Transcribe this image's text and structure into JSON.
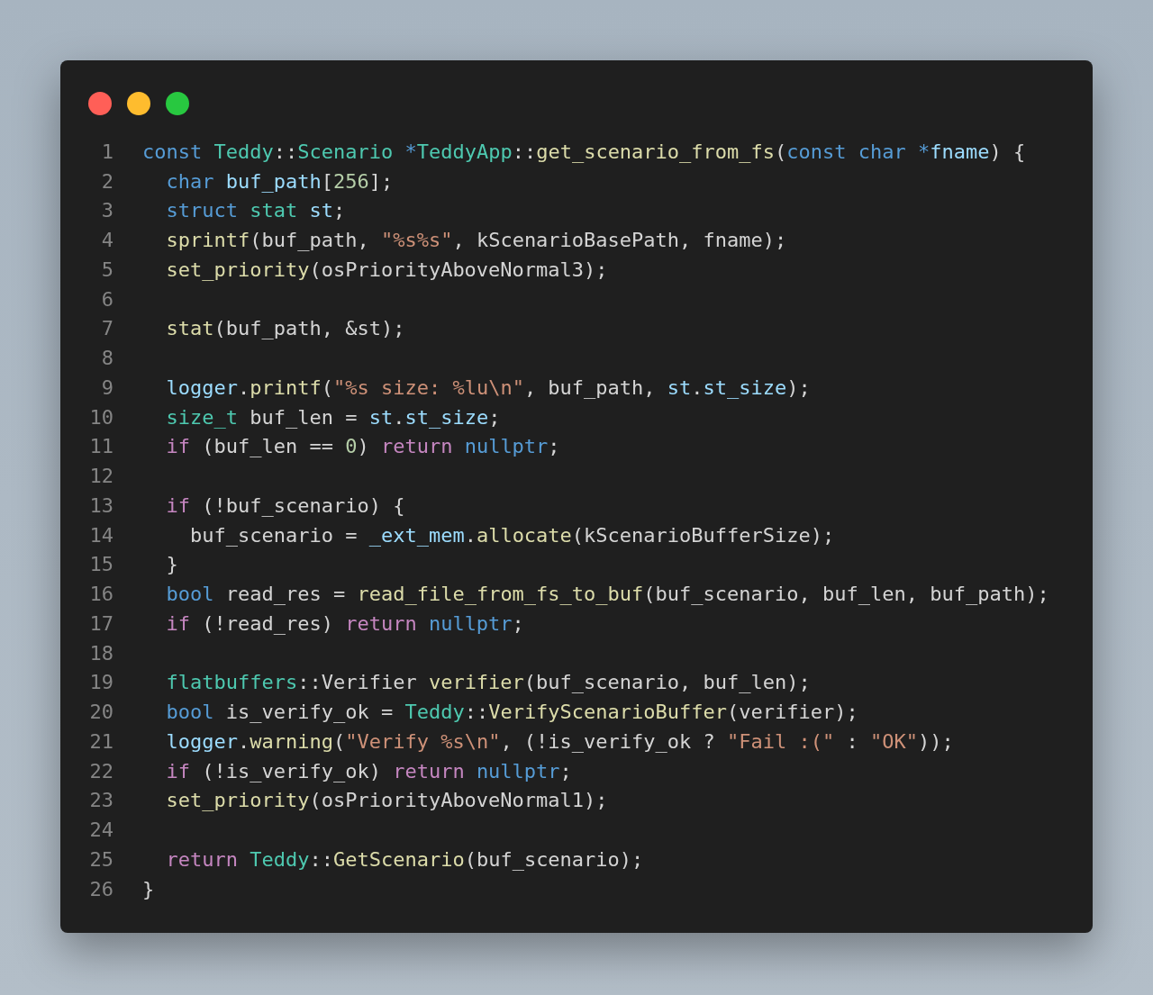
{
  "code_lines": [
    {
      "number": "1",
      "tokens": [
        {
          "kind": "keyword",
          "text": "const "
        },
        {
          "kind": "type",
          "text": "Teddy"
        },
        {
          "kind": "plain",
          "text": "::"
        },
        {
          "kind": "type",
          "text": "Scenario "
        },
        {
          "kind": "keyword",
          "text": "*"
        },
        {
          "kind": "type",
          "text": "TeddyApp"
        },
        {
          "kind": "plain",
          "text": "::"
        },
        {
          "kind": "function",
          "text": "get_scenario_from_fs"
        },
        {
          "kind": "plain",
          "text": "("
        },
        {
          "kind": "keyword",
          "text": "const char *"
        },
        {
          "kind": "variable",
          "text": "fname"
        },
        {
          "kind": "plain",
          "text": ") {"
        }
      ]
    },
    {
      "number": "2",
      "tokens": [
        {
          "kind": "keyword",
          "text": "  char "
        },
        {
          "kind": "variable",
          "text": "buf_path"
        },
        {
          "kind": "plain",
          "text": "["
        },
        {
          "kind": "number",
          "text": "256"
        },
        {
          "kind": "plain",
          "text": "];"
        }
      ]
    },
    {
      "number": "3",
      "tokens": [
        {
          "kind": "keyword",
          "text": "  struct "
        },
        {
          "kind": "type",
          "text": "stat "
        },
        {
          "kind": "variable",
          "text": "st"
        },
        {
          "kind": "plain",
          "text": ";"
        }
      ]
    },
    {
      "number": "4",
      "tokens": [
        {
          "kind": "function",
          "text": "  sprintf"
        },
        {
          "kind": "plain",
          "text": "(buf_path, "
        },
        {
          "kind": "string",
          "text": "\"%s%s\""
        },
        {
          "kind": "plain",
          "text": ", kScenarioBasePath, fname);"
        }
      ]
    },
    {
      "number": "5",
      "tokens": [
        {
          "kind": "function",
          "text": "  set_priority"
        },
        {
          "kind": "plain",
          "text": "(osPriorityAboveNormal3);"
        }
      ]
    },
    {
      "number": "6"
    },
    {
      "number": "7",
      "tokens": [
        {
          "kind": "function",
          "text": "  stat"
        },
        {
          "kind": "plain",
          "text": "(buf_path, &st);"
        }
      ]
    },
    {
      "number": "8"
    },
    {
      "number": "9",
      "tokens": [
        {
          "kind": "variable",
          "text": "  logger"
        },
        {
          "kind": "plain",
          "text": "."
        },
        {
          "kind": "function",
          "text": "printf"
        },
        {
          "kind": "plain",
          "text": "("
        },
        {
          "kind": "string",
          "text": "\"%s size: %lu\\n\""
        },
        {
          "kind": "plain",
          "text": ", buf_path, "
        },
        {
          "kind": "variable",
          "text": "st"
        },
        {
          "kind": "plain",
          "text": "."
        },
        {
          "kind": "variable",
          "text": "st_size"
        },
        {
          "kind": "plain",
          "text": ");"
        }
      ]
    },
    {
      "number": "10",
      "tokens": [
        {
          "kind": "type",
          "text": "  size_t"
        },
        {
          "kind": "plain",
          "text": " buf_len = "
        },
        {
          "kind": "variable",
          "text": "st"
        },
        {
          "kind": "plain",
          "text": "."
        },
        {
          "kind": "variable",
          "text": "st_size"
        },
        {
          "kind": "plain",
          "text": ";"
        }
      ]
    },
    {
      "number": "11",
      "tokens": [
        {
          "kind": "control",
          "text": "  if"
        },
        {
          "kind": "plain",
          "text": " (buf_len == "
        },
        {
          "kind": "number",
          "text": "0"
        },
        {
          "kind": "plain",
          "text": ") "
        },
        {
          "kind": "control",
          "text": "return "
        },
        {
          "kind": "keyword",
          "text": "nullptr"
        },
        {
          "kind": "plain",
          "text": ";"
        }
      ]
    },
    {
      "number": "12"
    },
    {
      "number": "13",
      "tokens": [
        {
          "kind": "control",
          "text": "  if"
        },
        {
          "kind": "plain",
          "text": " (!buf_scenario) {"
        }
      ]
    },
    {
      "number": "14",
      "tokens": [
        {
          "kind": "plain",
          "text": "    buf_scenario = "
        },
        {
          "kind": "variable",
          "text": "_ext_mem"
        },
        {
          "kind": "plain",
          "text": "."
        },
        {
          "kind": "function",
          "text": "allocate"
        },
        {
          "kind": "plain",
          "text": "(kScenarioBufferSize);"
        }
      ]
    },
    {
      "number": "15",
      "tokens": [
        {
          "kind": "plain",
          "text": "  }"
        }
      ]
    },
    {
      "number": "16",
      "tokens": [
        {
          "kind": "keyword",
          "text": "  bool"
        },
        {
          "kind": "plain",
          "text": " read_res = "
        },
        {
          "kind": "function",
          "text": "read_file_from_fs_to_buf"
        },
        {
          "kind": "plain",
          "text": "(buf_scenario, buf_len, buf_path);"
        }
      ]
    },
    {
      "number": "17",
      "tokens": [
        {
          "kind": "control",
          "text": "  if"
        },
        {
          "kind": "plain",
          "text": " (!read_res) "
        },
        {
          "kind": "control",
          "text": "return "
        },
        {
          "kind": "keyword",
          "text": "nullptr"
        },
        {
          "kind": "plain",
          "text": ";"
        }
      ]
    },
    {
      "number": "18"
    },
    {
      "number": "19",
      "tokens": [
        {
          "kind": "type",
          "text": "  flatbuffers"
        },
        {
          "kind": "plain",
          "text": "::Verifier "
        },
        {
          "kind": "function",
          "text": "verifier"
        },
        {
          "kind": "plain",
          "text": "(buf_scenario, buf_len);"
        }
      ]
    },
    {
      "number": "20",
      "tokens": [
        {
          "kind": "keyword",
          "text": "  bool"
        },
        {
          "kind": "plain",
          "text": " is_verify_ok = "
        },
        {
          "kind": "type",
          "text": "Teddy"
        },
        {
          "kind": "plain",
          "text": "::"
        },
        {
          "kind": "function",
          "text": "VerifyScenarioBuffer"
        },
        {
          "kind": "plain",
          "text": "(verifier);"
        }
      ]
    },
    {
      "number": "21",
      "tokens": [
        {
          "kind": "variable",
          "text": "  logger"
        },
        {
          "kind": "plain",
          "text": "."
        },
        {
          "kind": "function",
          "text": "warning"
        },
        {
          "kind": "plain",
          "text": "("
        },
        {
          "kind": "string",
          "text": "\"Verify %s\\n\""
        },
        {
          "kind": "plain",
          "text": ", (!is_verify_ok ? "
        },
        {
          "kind": "string",
          "text": "\"Fail :(\""
        },
        {
          "kind": "plain",
          "text": " : "
        },
        {
          "kind": "string",
          "text": "\"OK\""
        },
        {
          "kind": "plain",
          "text": "));"
        }
      ]
    },
    {
      "number": "22",
      "tokens": [
        {
          "kind": "control",
          "text": "  if"
        },
        {
          "kind": "plain",
          "text": " (!is_verify_ok) "
        },
        {
          "kind": "control",
          "text": "return "
        },
        {
          "kind": "keyword",
          "text": "nullptr"
        },
        {
          "kind": "plain",
          "text": ";"
        }
      ]
    },
    {
      "number": "23",
      "tokens": [
        {
          "kind": "function",
          "text": "  set_priority"
        },
        {
          "kind": "plain",
          "text": "(osPriorityAboveNormal1);"
        }
      ]
    },
    {
      "number": "24"
    },
    {
      "number": "25",
      "tokens": [
        {
          "kind": "control",
          "text": "  return "
        },
        {
          "kind": "type",
          "text": "Teddy"
        },
        {
          "kind": "plain",
          "text": "::"
        },
        {
          "kind": "function",
          "text": "GetScenario"
        },
        {
          "kind": "plain",
          "text": "(buf_scenario);"
        }
      ]
    },
    {
      "number": "26",
      "tokens": [
        {
          "kind": "plain",
          "text": "}"
        }
      ]
    }
  ]
}
